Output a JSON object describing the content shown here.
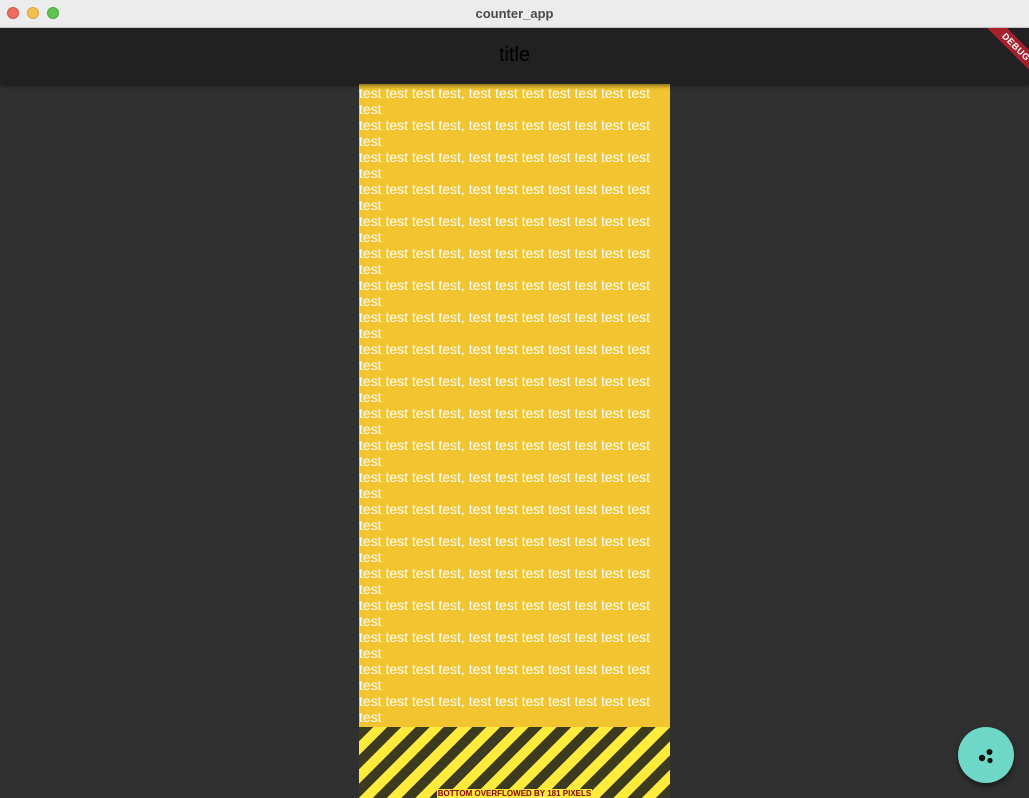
{
  "window": {
    "title": "counter_app"
  },
  "appbar": {
    "title": "title",
    "debug_label": "DEBUG"
  },
  "content": {
    "lines": [
      "test test test test, test test test test test test test test",
      "test test test test, test test test test test test test test",
      "test test test test, test test test test test test test test",
      "test test test test, test test test test test test test test",
      "test test test test, test test test test test test test test",
      "test test test test, test test test test test test test test",
      "test test test test, test test test test test test test test",
      "test test test test, test test test test test test test test",
      "test test test test, test test test test test test test test",
      "test test test test, test test test test test test test test",
      "test test test test, test test test test test test test test",
      "test test test test, test test test test test test test test",
      "test test test test, test test test test test test test test",
      "test test test test, test test test test test test test test",
      "test test test test, test test test test test test test test",
      "test test test test, test test test test test test test test",
      "test test test test, test test test test test test test test",
      "test test test test, test test test test test test test test",
      "test test test test, test test test test test test test test",
      "test test test test, test test test test test test test test"
    ],
    "overflow_message": "BOTTOM OVERFLOWED BY 181 PIXELS"
  },
  "fab": {
    "icon": "scatter-dots-icon"
  },
  "colors": {
    "column_bg": "#f2c42f",
    "fab_bg": "#6fd7c8",
    "debug_ribbon": "#a6212c"
  }
}
